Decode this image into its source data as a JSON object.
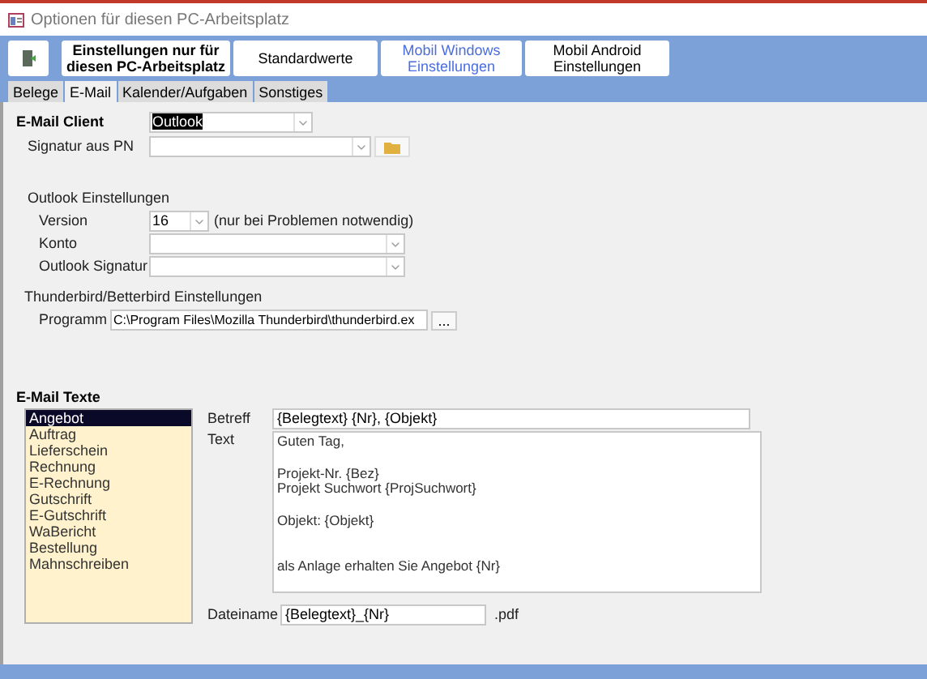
{
  "window": {
    "title": "Optionen für diesen PC-Arbeitsplatz"
  },
  "toolbar": [
    {
      "label": "Einstellungen nur für diesen PC-Arbeitsplatz",
      "kind": "bold"
    },
    {
      "label": "Standardwerte",
      "kind": "plain"
    },
    {
      "label": "Mobil Windows Einstellungen",
      "kind": "link"
    },
    {
      "label": "Mobil Android Einstellungen",
      "kind": "plain"
    }
  ],
  "tabs": [
    {
      "label": "Belege",
      "selected": false
    },
    {
      "label": "E-Mail",
      "selected": true
    },
    {
      "label": "Kalender/Aufgaben",
      "selected": false
    },
    {
      "label": "Sonstiges",
      "selected": false
    }
  ],
  "email_client": {
    "label": "E-Mail Client",
    "value": "Outlook"
  },
  "signature": {
    "label": "Signatur aus PN"
  },
  "outlook": {
    "heading": "Outlook Einstellungen",
    "version": {
      "label": "Version",
      "value": "16",
      "note": "(nur bei Problemen notwendig)"
    },
    "account": {
      "label": "Konto"
    },
    "signature": {
      "label": "Outlook Signatur"
    }
  },
  "thunderbird": {
    "heading": "Thunderbird/Betterbird Einstellungen",
    "program": {
      "label": "Programm",
      "value": "C:\\Program Files\\Mozilla Thunderbird\\thunderbird.ex",
      "button": "..."
    }
  },
  "texts": {
    "heading": "E-Mail Texte",
    "items": [
      {
        "label": "Angebot",
        "selected": true
      },
      {
        "label": "Auftrag",
        "selected": false
      },
      {
        "label": "Lieferschein",
        "selected": false
      },
      {
        "label": "Rechnung",
        "selected": false
      },
      {
        "label": "E-Rechnung",
        "selected": false
      },
      {
        "label": "Gutschrift",
        "selected": false
      },
      {
        "label": "E-Gutschrift",
        "selected": false
      },
      {
        "label": "WaBericht",
        "selected": false
      },
      {
        "label": "Bestellung",
        "selected": false
      },
      {
        "label": "Mahnschreiben",
        "selected": false
      }
    ],
    "subject": {
      "label": "Betreff",
      "value": "{Belegtext} {Nr}, {Objekt}"
    },
    "body": {
      "label": "Text",
      "paragraphs": [
        {
          "kind": "first",
          "lines": [
            "Guten Tag,"
          ]
        },
        {
          "kind": "normal",
          "lines": [
            "Projekt-Nr. {Bez}",
            "Projekt Suchwort {ProjSuchwort}"
          ]
        },
        {
          "kind": "normal",
          "lines": [
            "Objekt: {Objekt}"
          ]
        },
        {
          "kind": "after_gap",
          "lines": [
            "als Anlage erhalten Sie Angebot {Nr}"
          ]
        }
      ]
    },
    "filename": {
      "label": "Dateiname",
      "value": "{Belegtext}_{Nr}",
      "extension": ".pdf"
    }
  }
}
